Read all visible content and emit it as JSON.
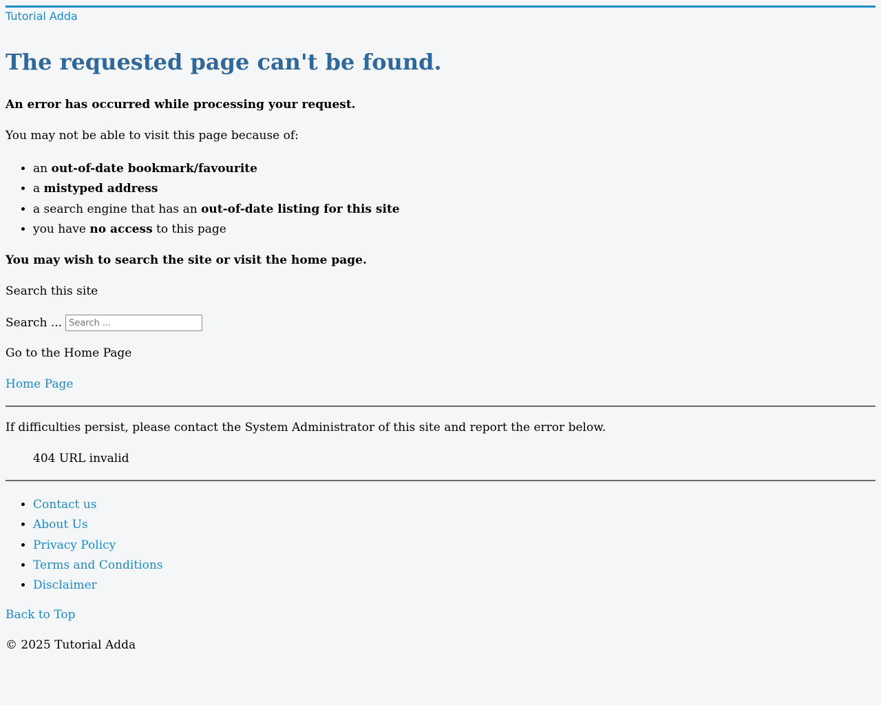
{
  "header": {
    "brand": "Tutorial Adda"
  },
  "main": {
    "title": "The requested page can't be found.",
    "error_message": "An error has occurred while processing your request.",
    "because_intro": "You may not be able to visit this page because of:",
    "reasons": [
      {
        "prefix": "an ",
        "bold": "out-of-date bookmark/favourite",
        "suffix": ""
      },
      {
        "prefix": "a ",
        "bold": "mistyped address",
        "suffix": ""
      },
      {
        "prefix": "a search engine that has an ",
        "bold": "out-of-date listing for this site",
        "suffix": ""
      },
      {
        "prefix": "you have ",
        "bold": "no access",
        "suffix": " to this page"
      }
    ],
    "wish_text": "You may wish to search the site or visit the home page.",
    "search_heading": "Search this site",
    "search_label": "Search ...",
    "search_placeholder": "Search ...",
    "search_value": "",
    "go_home_text": "Go to the Home Page",
    "home_link": "Home Page",
    "persist_text": "If difficulties persist, please contact the System Administrator of this site and report the error below.",
    "error_code": "404 URL invalid"
  },
  "footer": {
    "links": [
      "Contact us",
      "About Us",
      "Privacy Policy",
      "Terms and Conditions",
      "Disclaimer"
    ],
    "back_to_top": "Back to Top",
    "copyright": "© 2025 Tutorial Adda"
  },
  "colors": {
    "accent": "#1b8bc3",
    "title": "#2f6899",
    "background": "#f4f6f7"
  }
}
